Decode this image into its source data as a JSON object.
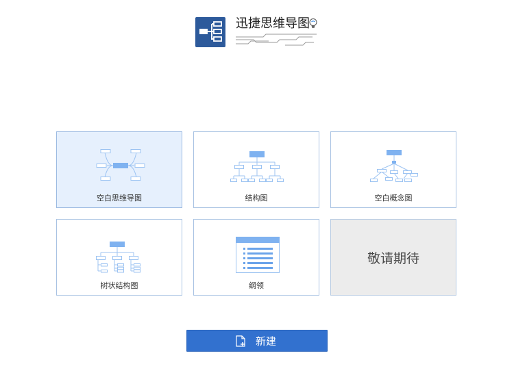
{
  "header": {
    "app_title": "迅捷思维导图",
    "logo_icon": "mindmap-logo-icon",
    "bulb_icon": "lightbulb-icon"
  },
  "templates": [
    {
      "label": "空白思维导图",
      "icon": "blank-mindmap-icon",
      "selected": true
    },
    {
      "label": "结构图",
      "icon": "org-chart-icon"
    },
    {
      "label": "空白概念图",
      "icon": "concept-map-icon"
    },
    {
      "label": "树状结构图",
      "icon": "tree-chart-icon"
    },
    {
      "label": "纲领",
      "icon": "outline-list-icon"
    },
    {
      "label": "敬请期待",
      "icon": "",
      "disabled": true
    }
  ],
  "actions": {
    "new_label": "新建",
    "new_icon": "new-document-icon"
  },
  "colors": {
    "accent": "#3271cf",
    "logo_bg": "#2d5a9b",
    "card_border": "#a9c3e3",
    "selected_bg": "#e6f0fd",
    "disabled_bg": "#ececec",
    "illustration_blue": "#7fb2f0"
  }
}
